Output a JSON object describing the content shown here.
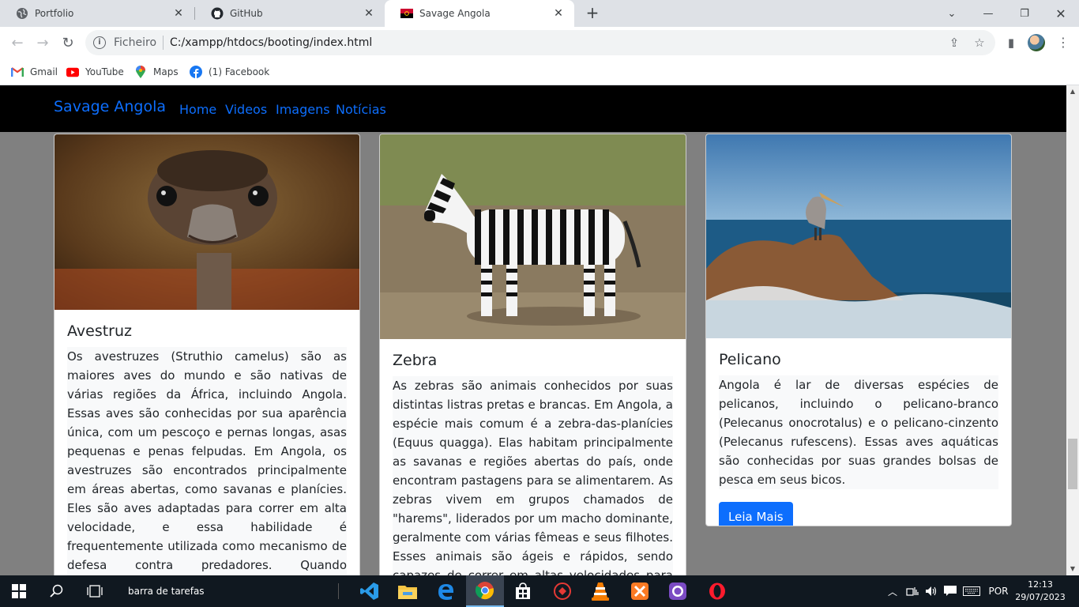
{
  "browser": {
    "tabs": [
      {
        "title": "Portfolio",
        "icon": "globe-icon",
        "active": false
      },
      {
        "title": "GitHub",
        "icon": "github-icon",
        "active": false
      },
      {
        "title": "Savage Angola",
        "icon": "angola-flag-icon",
        "active": true
      }
    ],
    "omnibox": {
      "scheme": "Ficheiro",
      "url": "C:/xampp/htdocs/booting/index.html"
    },
    "bookmarks": [
      {
        "label": "Gmail",
        "icon": "gmail-icon"
      },
      {
        "label": "YouTube",
        "icon": "youtube-icon"
      },
      {
        "label": "Maps",
        "icon": "maps-icon"
      },
      {
        "label": "(1) Facebook",
        "icon": "facebook-icon"
      }
    ]
  },
  "site": {
    "brand": "Savage Angola",
    "nav": [
      "Home",
      "Videos",
      "Imagens",
      "Notícias"
    ],
    "accent": "#0d6efd",
    "cards": [
      {
        "title": "Avestruz",
        "image": "ostrich-photo",
        "text": "Os avestruzes (Struthio camelus) são as maiores aves do mundo e são nativas de várias regiões da África, incluindo Angola. Essas aves são conhecidas por sua aparência única, com um pescoço e pernas longas, asas pequenas e penas felpudas. Em Angola, os avestruzes são encontrados principalmente em áreas abertas, como savanas e planícies. Eles são aves adaptadas para correr em alta velocidade, e essa habilidade é frequentemente utilizada como mecanismo de defesa contra predadores. Quando ameaçados, os avestruzes correm a velocidades impressionantes,"
      },
      {
        "title": "Zebra",
        "image": "zebra-photo",
        "text": "As zebras são animais conhecidos por suas distintas listras pretas e brancas. Em Angola, a espécie mais comum é a zebra-das-planícies (Equus quagga). Elas habitam principalmente as savanas e regiões abertas do país, onde encontram pastagens para se alimentarem. As zebras vivem em grupos chamados de \"harems\", liderados por um macho dominante, geralmente com várias fêmeas e seus filhotes. Esses animais são ágeis e rápidos, sendo capazes de correr em altas velocidades para escapar de predadores"
      },
      {
        "title": "Pelicano",
        "image": "pelican-photo",
        "text": "Angola é lar de diversas espécies de pelicanos, incluindo o pelicano-branco (Pelecanus onocrotalus) e o pelicano-cinzento (Pelecanus rufescens). Essas aves aquáticas são conhecidas por suas grandes bolsas de pesca em seus bicos.",
        "button": "Leia Mais"
      }
    ]
  },
  "taskbar": {
    "search_text": "barra de tarefas",
    "apps": [
      "vscode-icon",
      "file-explorer-icon",
      "edge-icon",
      "chrome-icon",
      "store-icon",
      "app-icon",
      "vlc-icon",
      "xampp-icon",
      "github-desktop-icon",
      "opera-icon"
    ],
    "language": "POR",
    "time": "12:13",
    "date": "29/07/2023"
  }
}
